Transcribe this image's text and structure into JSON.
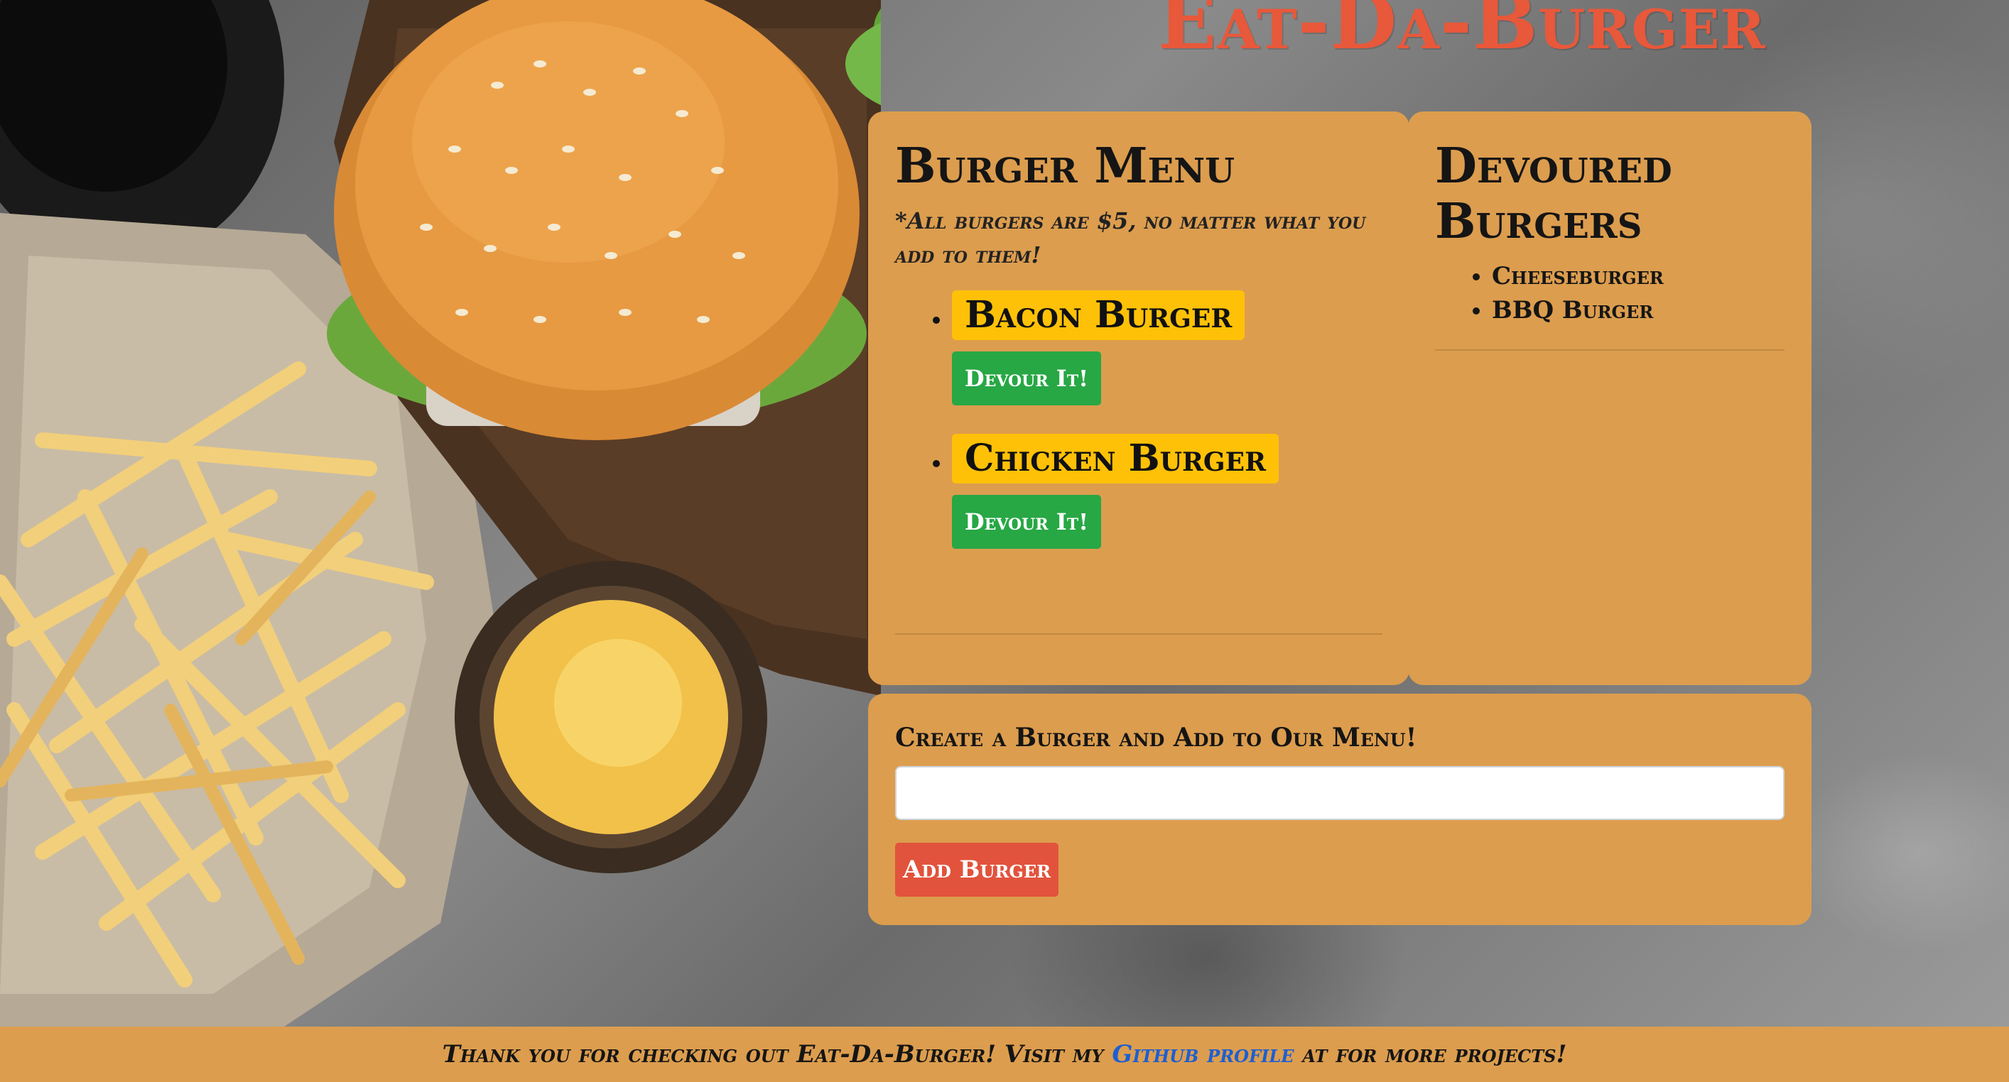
{
  "header": {
    "title": "Eat-Da-Burger"
  },
  "menu": {
    "heading": "Burger Menu",
    "note": "*All burgers are $5, no matter what you add to them!",
    "items": [
      {
        "name": "Bacon Burger",
        "button": "Devour It!"
      },
      {
        "name": "Chicken Burger",
        "button": "Devour It!"
      }
    ]
  },
  "devoured": {
    "heading": "Devoured Burgers",
    "items": [
      "Cheeseburger",
      "BBQ Burger"
    ]
  },
  "form": {
    "label": "Create a Burger and Add to Our Menu!",
    "value": "",
    "button": "Add Burger"
  },
  "footer": {
    "before": "Thank you for checking out Eat-Da-Burger! Visit my ",
    "link": "Github profile",
    "after": " at for more projects!"
  },
  "colors": {
    "title": "#e8583a",
    "card": "#dc9d4e",
    "badge": "#ffc107",
    "devour_button": "#28a745",
    "add_button": "#e2533d",
    "link": "#1d5fd1"
  }
}
